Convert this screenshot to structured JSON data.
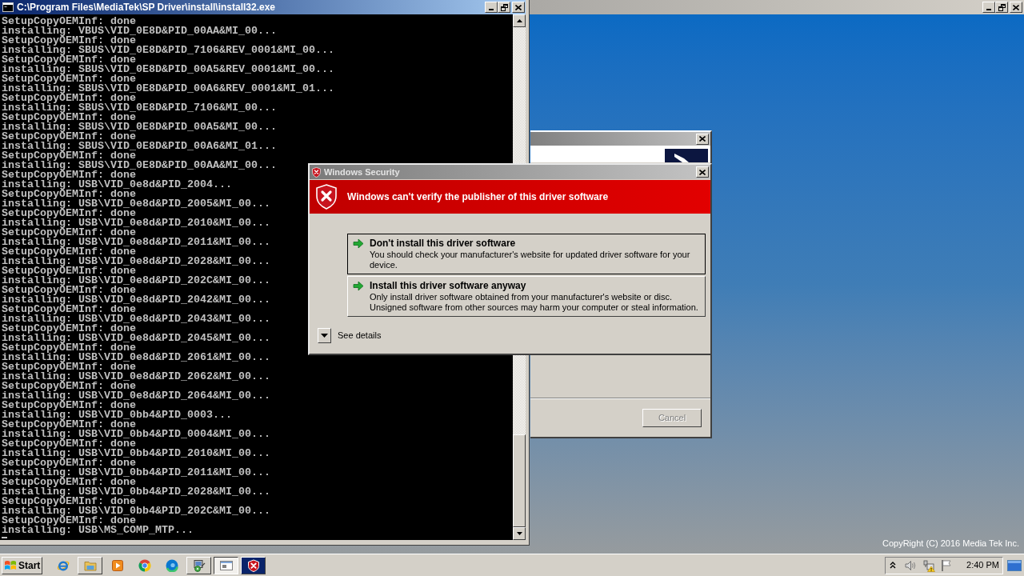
{
  "background_window": {
    "footer_text": "CopyRight (C) 2016 Media Tek Inc."
  },
  "console_window": {
    "title": "C:\\Program Files\\MediaTek\\SP Driver\\install\\install32.exe",
    "lines": [
      "SetupCopyOEMInf: done",
      "installing: VBUS\\VID_0E8D&PID_00AA&MI_00...",
      "SetupCopyOEMInf: done",
      "installing: SBUS\\VID_0E8D&PID_7106&REV_0001&MI_00...",
      "SetupCopyOEMInf: done",
      "installing: SBUS\\VID_0E8D&PID_00A5&REV_0001&MI_00...",
      "SetupCopyOEMInf: done",
      "installing: SBUS\\VID_0E8D&PID_00A6&REV_0001&MI_01...",
      "SetupCopyOEMInf: done",
      "installing: SBUS\\VID_0E8D&PID_7106&MI_00...",
      "SetupCopyOEMInf: done",
      "installing: SBUS\\VID_0E8D&PID_00A5&MI_00...",
      "SetupCopyOEMInf: done",
      "installing: SBUS\\VID_0E8D&PID_00A6&MI_01...",
      "SetupCopyOEMInf: done",
      "installing: SBUS\\VID_0E8D&PID_00AA&MI_00...",
      "SetupCopyOEMInf: done",
      "installing: USB\\VID_0e8d&PID_2004...",
      "SetupCopyOEMInf: done",
      "installing: USB\\VID_0e8d&PID_2005&MI_00...",
      "SetupCopyOEMInf: done",
      "installing: USB\\VID_0e8d&PID_2010&MI_00...",
      "SetupCopyOEMInf: done",
      "installing: USB\\VID_0e8d&PID_2011&MI_00...",
      "SetupCopyOEMInf: done",
      "installing: USB\\VID_0e8d&PID_2028&MI_00...",
      "SetupCopyOEMInf: done",
      "installing: USB\\VID_0e8d&PID_202C&MI_00...",
      "SetupCopyOEMInf: done",
      "installing: USB\\VID_0e8d&PID_2042&MI_00...",
      "SetupCopyOEMInf: done",
      "installing: USB\\VID_0e8d&PID_2043&MI_00...",
      "SetupCopyOEMInf: done",
      "installing: USB\\VID_0e8d&PID_2045&MI_00...",
      "SetupCopyOEMInf: done",
      "installing: USB\\VID_0e8d&PID_2061&MI_00...",
      "SetupCopyOEMInf: done",
      "installing: USB\\VID_0e8d&PID_2062&MI_00...",
      "SetupCopyOEMInf: done",
      "installing: USB\\VID_0e8d&PID_2064&MI_00...",
      "SetupCopyOEMInf: done",
      "installing: USB\\VID_0bb4&PID_0003...",
      "SetupCopyOEMInf: done",
      "installing: USB\\VID_0bb4&PID_0004&MI_00...",
      "SetupCopyOEMInf: done",
      "installing: USB\\VID_0bb4&PID_2010&MI_00...",
      "SetupCopyOEMInf: done",
      "installing: USB\\VID_0bb4&PID_2011&MI_00...",
      "SetupCopyOEMInf: done",
      "installing: USB\\VID_0bb4&PID_2028&MI_00...",
      "SetupCopyOEMInf: done",
      "installing: USB\\VID_0bb4&PID_202C&MI_00...",
      "SetupCopyOEMInf: done",
      "installing: USB\\MS_COMP_MTP..."
    ]
  },
  "installer_window": {
    "cancel_button": {
      "label": "Cancel",
      "disabled": true
    }
  },
  "security_dialog": {
    "title": "Windows Security",
    "banner": "Windows can't verify the publisher of this driver software",
    "options": [
      {
        "title": "Don't install this driver software",
        "description": "You should check your manufacturer's website for updated driver software for your device.",
        "focused": true
      },
      {
        "title": "Install this driver software anyway",
        "description": "Only install driver software obtained from your manufacturer's website or disc. Unsigned software from other sources may harm your computer or steal information.",
        "focused": false
      }
    ],
    "details_toggle": {
      "label": "See details",
      "expanded": false
    }
  },
  "taskbar": {
    "start_label": "Start",
    "quick_launch": [
      {
        "highlighted": false
      },
      {
        "highlighted": true
      },
      {
        "highlighted": false
      },
      {
        "highlighted": false
      },
      {
        "highlighted": false
      }
    ],
    "task_buttons": [
      {
        "selected": false,
        "flashing": false
      },
      {
        "selected": true,
        "flashing": false
      },
      {
        "selected": false,
        "flashing": true
      }
    ],
    "clock": "2:40 PM"
  }
}
